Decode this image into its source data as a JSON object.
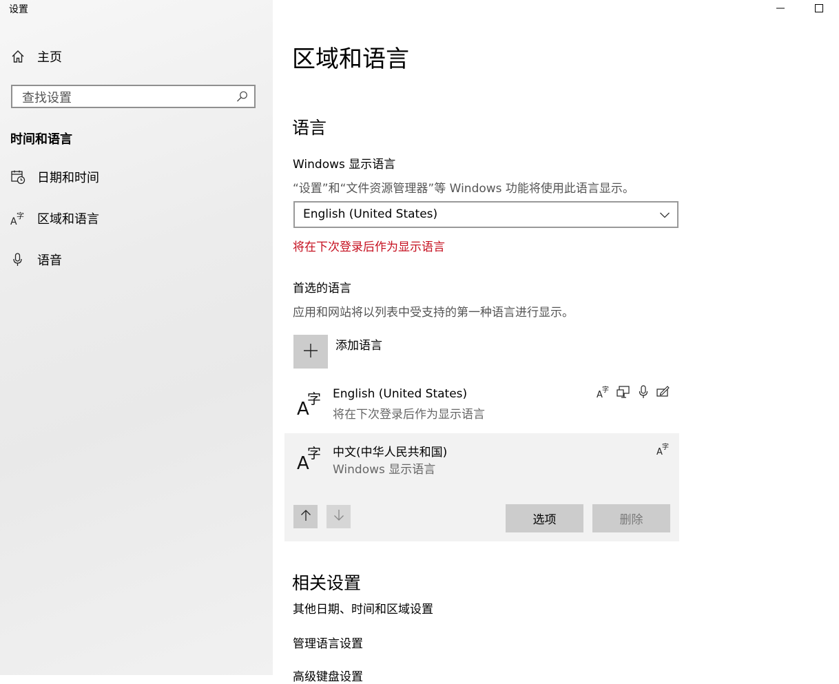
{
  "window": {
    "title": "设置"
  },
  "sidebar": {
    "home_label": "主页",
    "search_placeholder": "查找设置",
    "section_title": "时间和语言",
    "items": [
      {
        "label": "日期和时间",
        "icon": "calendar-clock-icon"
      },
      {
        "label": "区域和语言",
        "icon": "language-icon"
      },
      {
        "label": "语音",
        "icon": "microphone-icon"
      }
    ]
  },
  "main": {
    "title": "区域和语言",
    "language_heading": "语言",
    "display_language": {
      "label": "Windows 显示语言",
      "description": "“设置”和“文件资源管理器”等 Windows 功能将使用此语言显示。",
      "selected": "English (United States)",
      "notice": "将在下次登录后作为显示语言"
    },
    "preferred": {
      "label": "首选的语言",
      "description": "应用和网站将以列表中受支持的第一种语言进行显示。",
      "add_label": "添加语言",
      "languages": [
        {
          "name": "English (United States)",
          "status": "将在下次登录后作为显示语言",
          "features": [
            "language-pack-icon",
            "display-icon",
            "microphone-icon",
            "handwriting-icon"
          ]
        },
        {
          "name": "中文(中华人民共和国)",
          "status": "Windows 显示语言",
          "features": [
            "language-pack-icon"
          ]
        }
      ],
      "options_label": "选项",
      "remove_label": "删除"
    },
    "related": {
      "heading": "相关设置",
      "links": [
        "其他日期、时间和区域设置",
        "管理语言设置",
        "高级键盘设置"
      ]
    }
  },
  "colors": {
    "accent_warning": "#c50f1f",
    "sidebar_bg": "#eeeeee",
    "button_bg": "#cccccc",
    "selected_row_bg": "#f2f2f2"
  }
}
